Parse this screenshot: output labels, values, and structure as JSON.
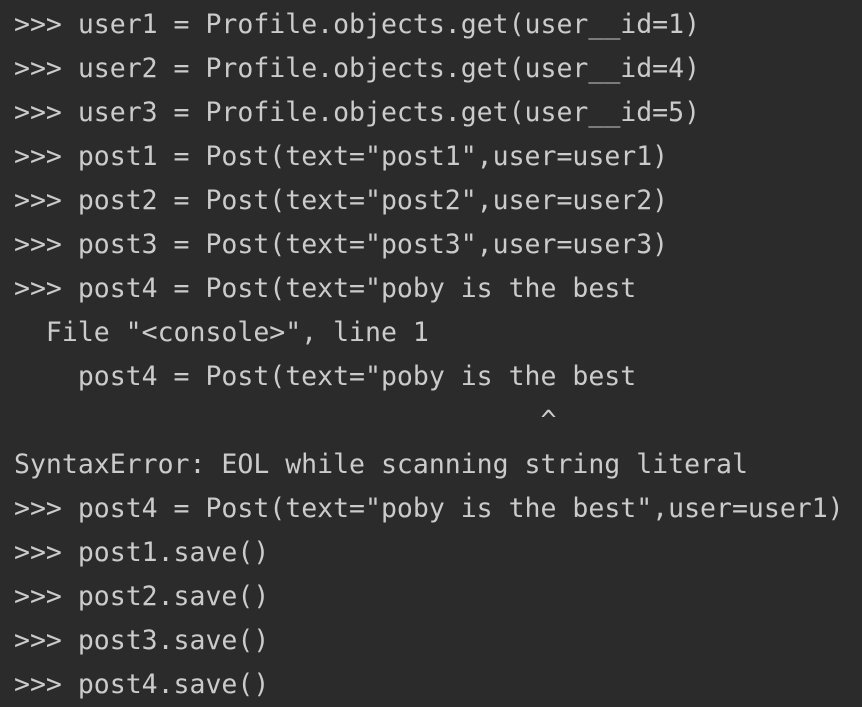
{
  "console": {
    "lines": [
      {
        "prompt": ">>> ",
        "text": "user1 = Profile.objects.get(user__id=1)"
      },
      {
        "prompt": ">>> ",
        "text": "user2 = Profile.objects.get(user__id=4)"
      },
      {
        "prompt": ">>> ",
        "text": "user3 = Profile.objects.get(user__id=5)"
      },
      {
        "prompt": ">>> ",
        "text": "post1 = Post(text=\"post1\",user=user1)"
      },
      {
        "prompt": ">>> ",
        "text": "post2 = Post(text=\"post2\",user=user2)"
      },
      {
        "prompt": ">>> ",
        "text": "post3 = Post(text=\"post3\",user=user3)"
      },
      {
        "prompt": ">>> ",
        "text": "post4 = Post(text=\"poby is the best"
      },
      {
        "prompt": "",
        "text": "  File \"<console>\", line 1"
      },
      {
        "prompt": "",
        "text": "    post4 = Post(text=\"poby is the best"
      },
      {
        "prompt": "",
        "text": "                                 ^"
      },
      {
        "prompt": "",
        "text": "SyntaxError: EOL while scanning string literal"
      },
      {
        "prompt": ">>> ",
        "text": "post4 = Post(text=\"poby is the best\",user=user1)"
      },
      {
        "prompt": ">>> ",
        "text": "post1.save()"
      },
      {
        "prompt": ">>> ",
        "text": "post2.save()"
      },
      {
        "prompt": ">>> ",
        "text": "post3.save()"
      },
      {
        "prompt": ">>> ",
        "text": "post4.save()"
      }
    ]
  }
}
